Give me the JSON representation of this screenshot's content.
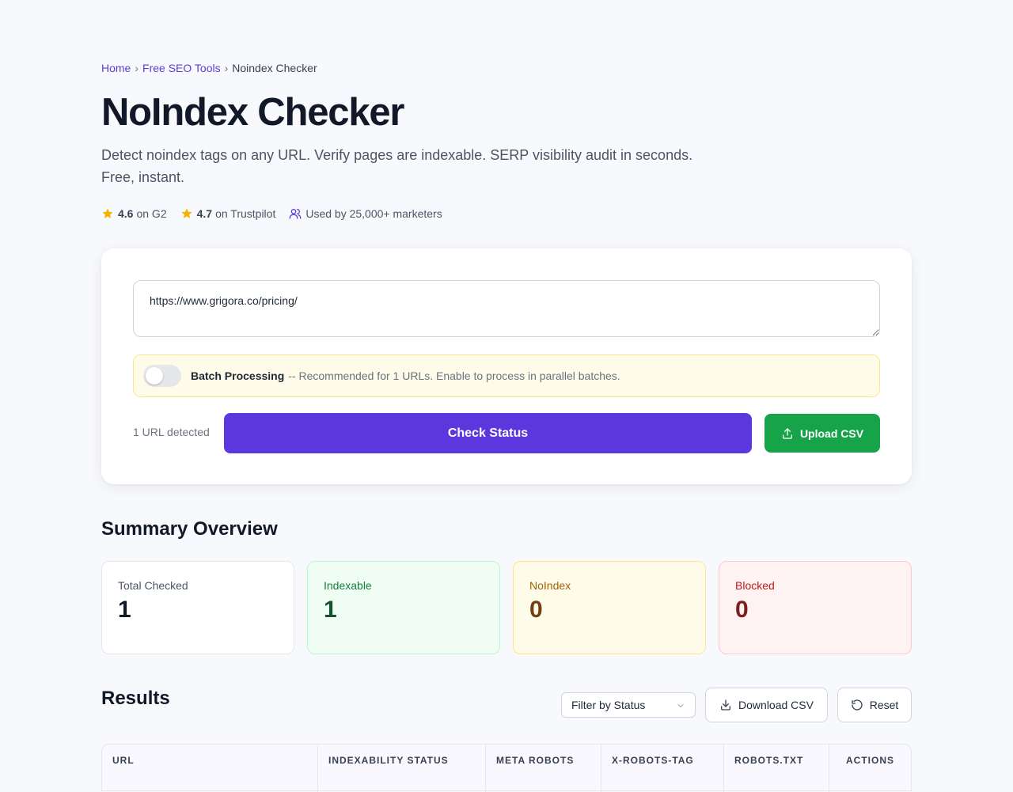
{
  "breadcrumb": {
    "home": "Home",
    "tools": "Free SEO Tools",
    "current": "Noindex Checker",
    "separator": "›"
  },
  "page": {
    "title": "NoIndex Checker",
    "subtitle": "Detect noindex tags on any URL. Verify pages are indexable. SERP visibility audit in seconds. Free, instant."
  },
  "ratings": {
    "g2_score": "4.6",
    "g2_label": "on G2",
    "trustpilot_score": "4.7",
    "trustpilot_label": "on Trustpilot",
    "users": "Used by 25,000+ marketers"
  },
  "checker": {
    "url_value": "https://www.grigora.co/pricing/",
    "batch_label": "Batch Processing",
    "batch_hint": "-- Recommended for 1 URLs. Enable to process in parallel batches.",
    "batch_enabled": false,
    "detected": "1 URL detected",
    "check_button": "Check Status",
    "upload_button": "Upload CSV"
  },
  "summary": {
    "heading": "Summary Overview",
    "total_label": "Total Checked",
    "total_value": "1",
    "indexable_label": "Indexable",
    "indexable_value": "1",
    "noindex_label": "NoIndex",
    "noindex_value": "0",
    "blocked_label": "Blocked",
    "blocked_value": "0"
  },
  "results": {
    "heading": "Results",
    "filter_selected": "Filter by Status",
    "download_button": "Download CSV",
    "reset_button": "Reset",
    "columns": [
      "URL",
      "Indexability Status",
      "Meta Robots",
      "X-Robots-Tag",
      "Robots.txt",
      "Actions"
    ]
  },
  "colors": {
    "primary": "#5b37dd",
    "success": "#16a34a",
    "star": "#f5b301",
    "link": "#5b3fd6"
  },
  "icons": {
    "star": "star-icon",
    "users": "users-icon",
    "upload": "upload-icon",
    "download": "download-icon",
    "reset": "reset-icon",
    "chevron": "chevron-down-icon"
  }
}
